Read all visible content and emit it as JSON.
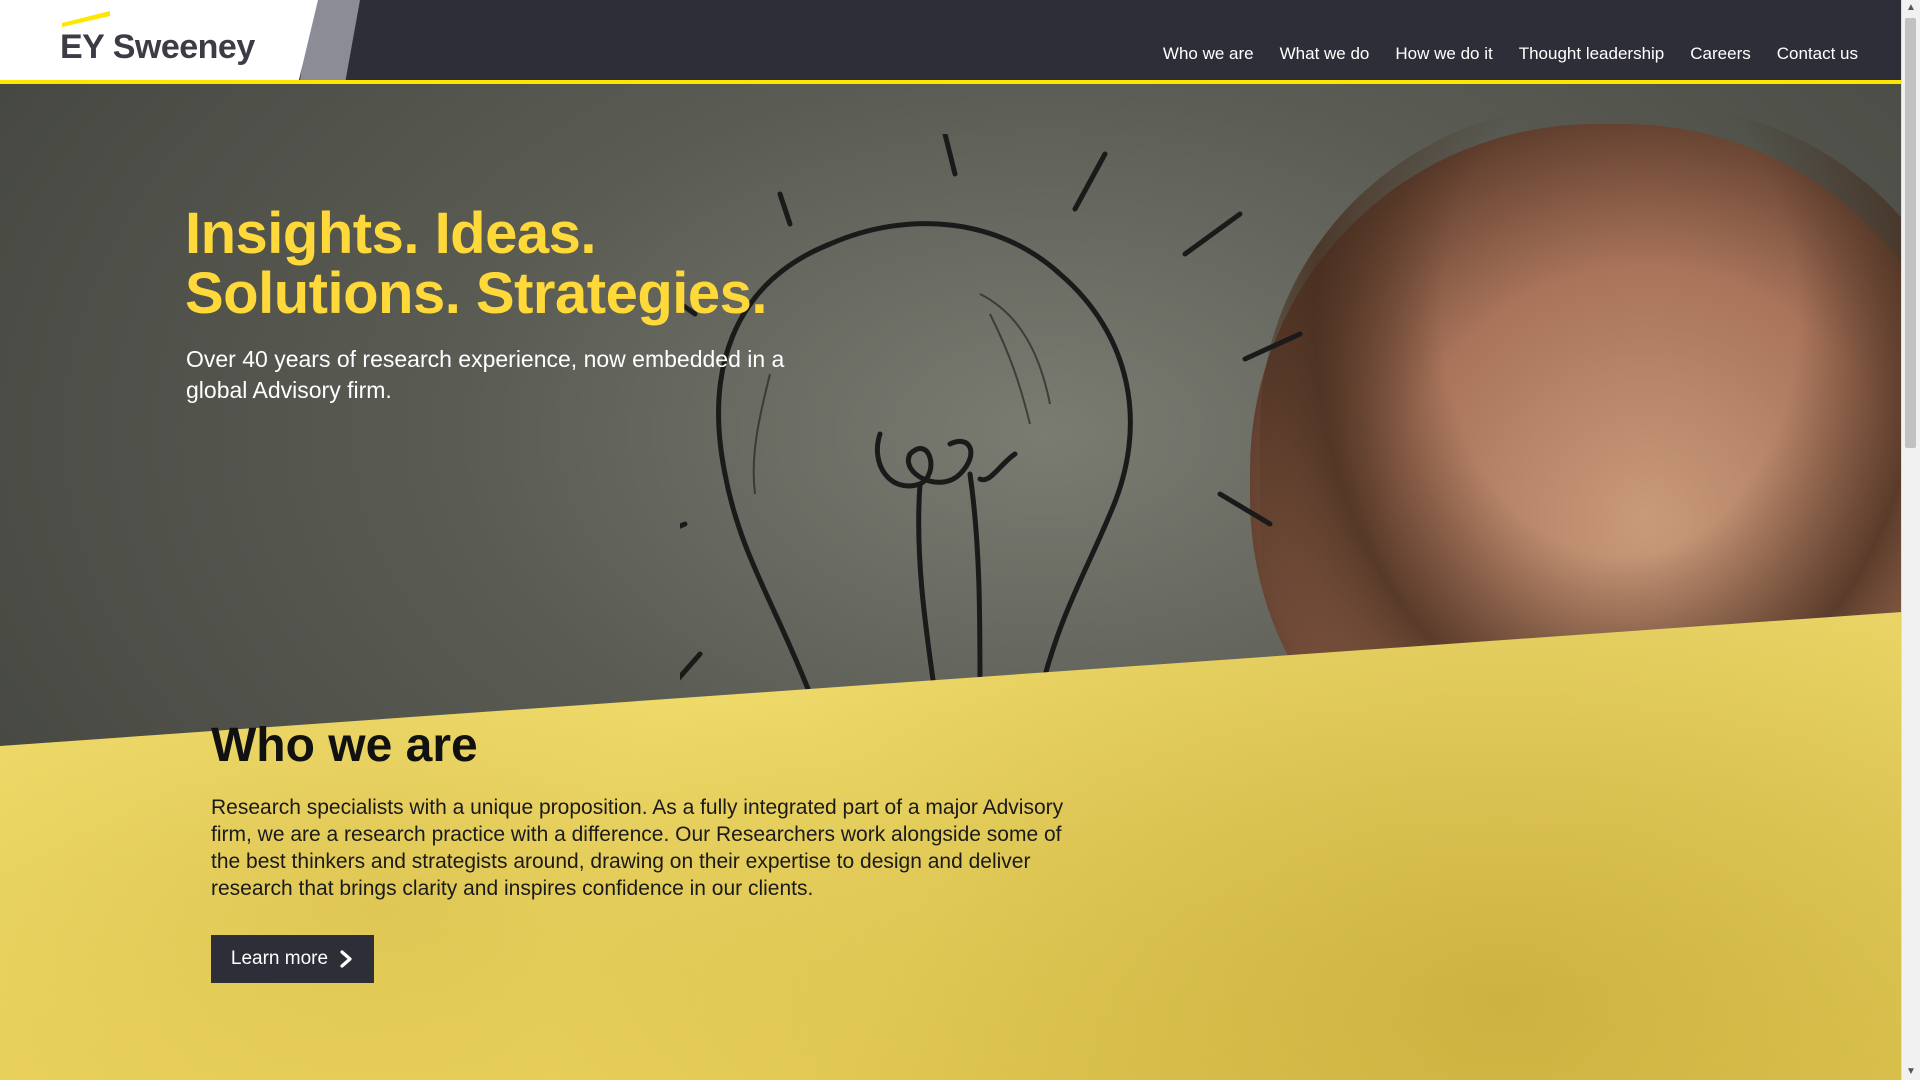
{
  "brand": {
    "logo_text_ey": "EY",
    "logo_text_name": "Sweeney",
    "accent_color": "#ffe600",
    "dark_color": "#2e2e38"
  },
  "nav": {
    "items": [
      "Who we are",
      "What we do",
      "How we do it",
      "Thought leadership",
      "Careers",
      "Contact us"
    ]
  },
  "hero": {
    "title_line1": "Insights. Ideas.",
    "title_line2": "Solutions. Strategies.",
    "subtitle": "Over 40 years of research experience, now embedded in a global Advisory firm."
  },
  "who_we_are": {
    "title": "Who we are",
    "body": "Research specialists with a unique proposition. As a fully integrated part of a major Advisory firm, we are a research practice with a difference. Our Researchers work alongside some of the best thinkers and strategists around, drawing on their expertise to design and deliver research that brings clarity and inspires confidence in our clients.",
    "cta_label": "Learn more",
    "cta_icon": "chevron-right-icon"
  }
}
